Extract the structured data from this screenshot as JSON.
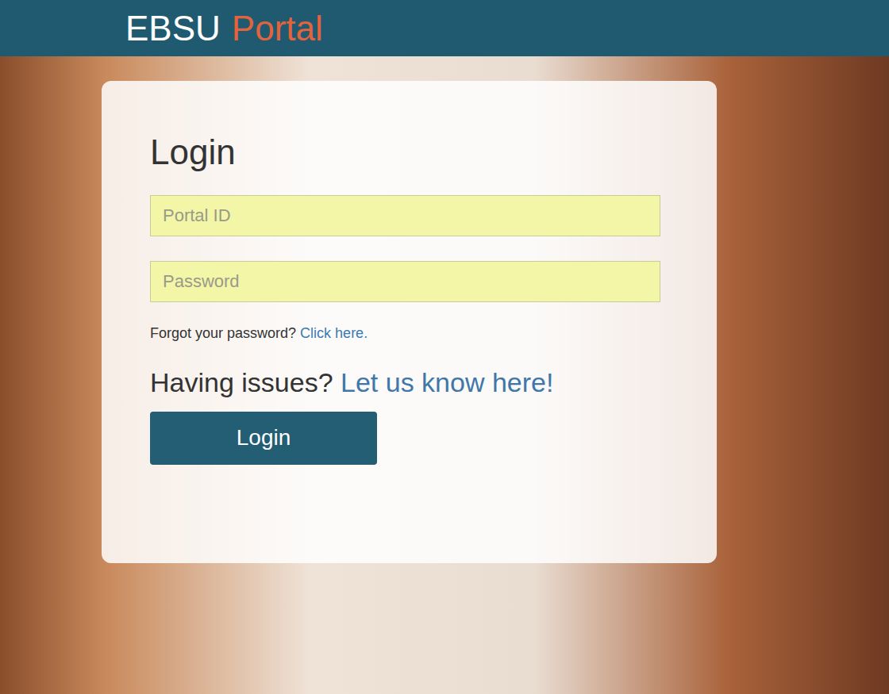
{
  "header": {
    "brand": "EBSU",
    "brand_accent": "Portal"
  },
  "form": {
    "title": "Login",
    "fields": [
      {
        "placeholder": "Portal ID",
        "kind": "text"
      },
      {
        "placeholder": "Password",
        "kind": "password"
      }
    ],
    "forgot": {
      "text": "Forgot your password?",
      "link": "Click here."
    },
    "issues": {
      "text": "Having issues?",
      "link": "Let us know here!"
    },
    "button": "Login"
  }
}
